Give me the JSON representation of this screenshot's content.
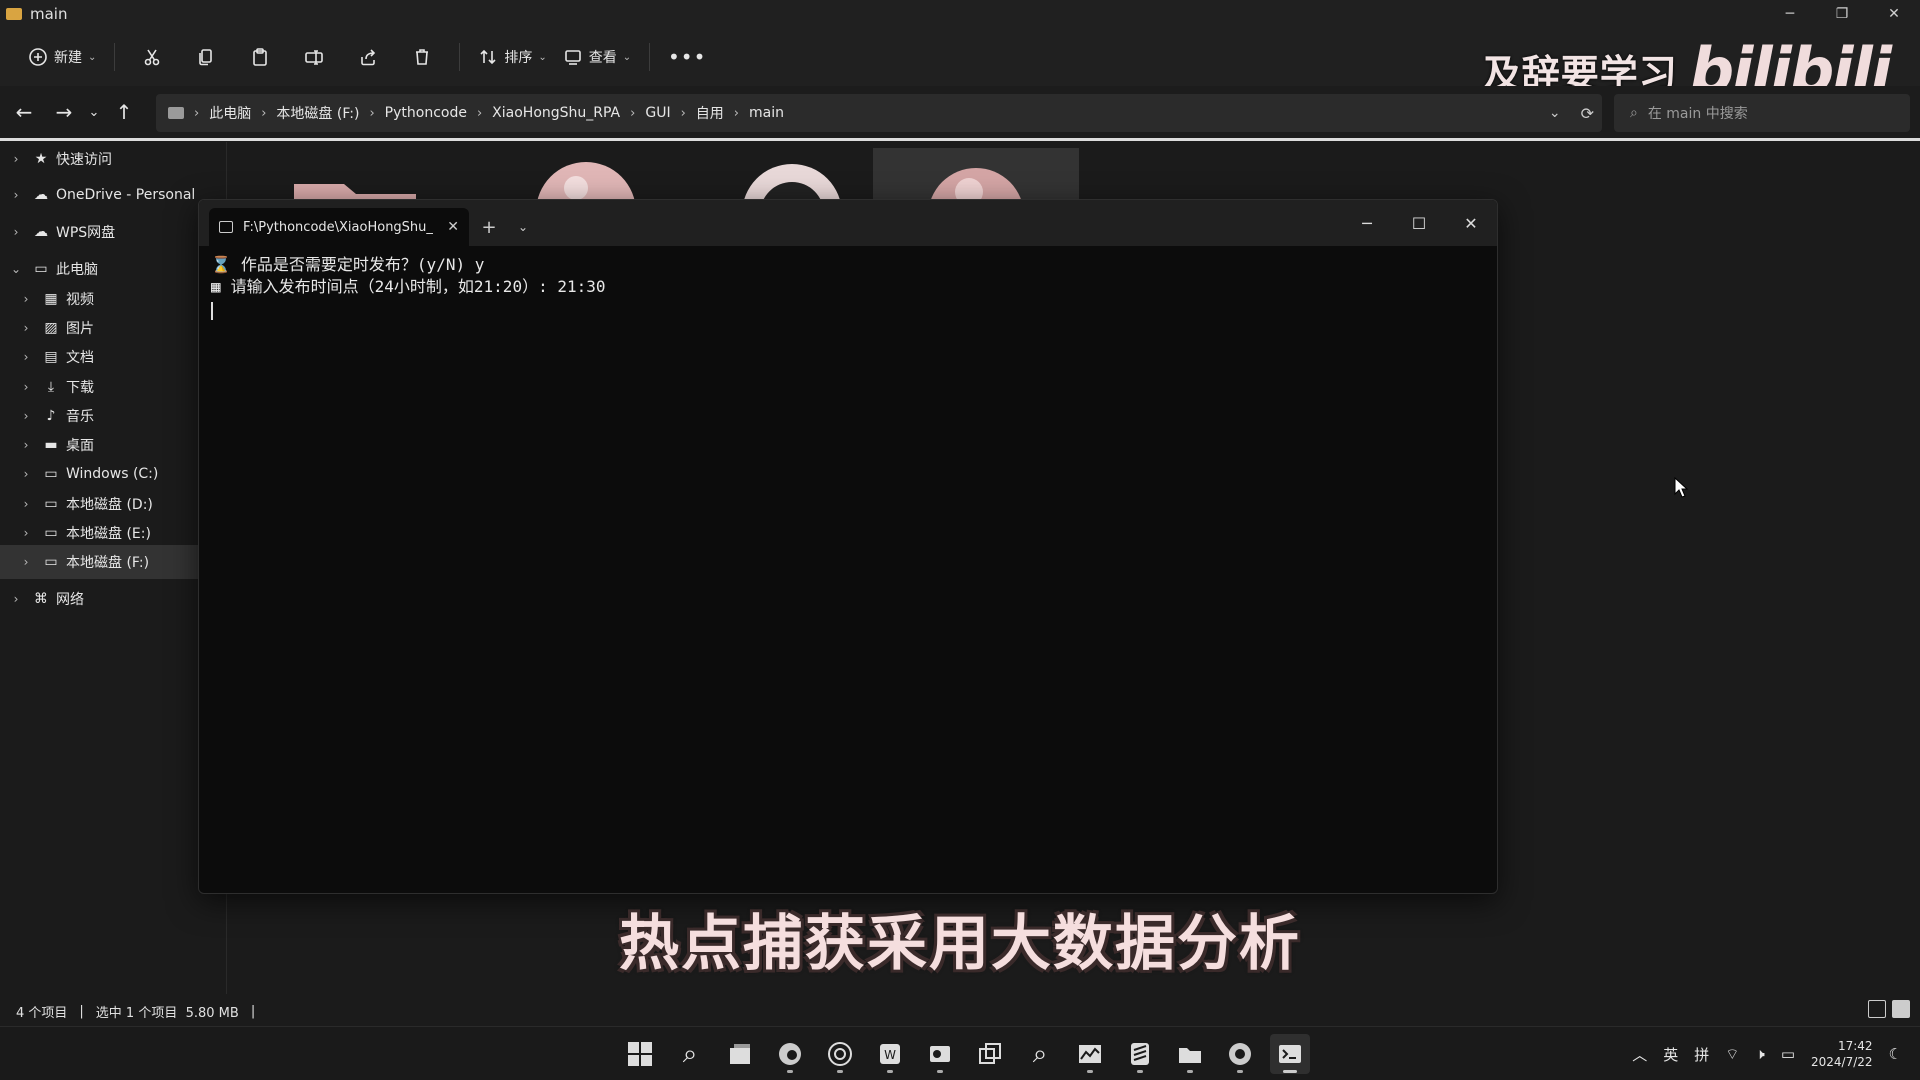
{
  "window": {
    "title": "main"
  },
  "toolbar": {
    "new_label": "新建",
    "sort_label": "排序",
    "view_label": "查看"
  },
  "watermark": {
    "text": "及辞要学习",
    "logo": "bilibili"
  },
  "breadcrumb": [
    "此电脑",
    "本地磁盘 (F:)",
    "Pythoncode",
    "XiaoHongShu_RPA",
    "GUI",
    "自用",
    "main"
  ],
  "search": {
    "placeholder": "在 main 中搜索"
  },
  "sidebar": {
    "items": [
      {
        "label": "快速访问",
        "icon": "star-icon"
      },
      {
        "label": "OneDrive - Personal",
        "icon": "cloud-icon"
      },
      {
        "label": "WPS网盘",
        "icon": "wps-cloud-icon"
      },
      {
        "label": "此电脑",
        "icon": "computer-icon"
      },
      {
        "label": "视频",
        "icon": "video-icon"
      },
      {
        "label": "图片",
        "icon": "picture-icon"
      },
      {
        "label": "文档",
        "icon": "document-icon"
      },
      {
        "label": "下载",
        "icon": "download-icon"
      },
      {
        "label": "音乐",
        "icon": "music-icon"
      },
      {
        "label": "桌面",
        "icon": "desktop-icon"
      },
      {
        "label": "Windows (C:)",
        "icon": "drive-icon"
      },
      {
        "label": "本地磁盘 (D:)",
        "icon": "drive-icon"
      },
      {
        "label": "本地磁盘 (E:)",
        "icon": "drive-icon"
      },
      {
        "label": "本地磁盘 (F:)",
        "icon": "drive-icon"
      },
      {
        "label": "网络",
        "icon": "network-icon"
      }
    ]
  },
  "terminal": {
    "tab_title": "F:\\Pythoncode\\XiaoHongShu_",
    "lines": [
      {
        "icon": "hourglass-icon",
        "text": "作品是否需要定时发布？(y/N) y"
      },
      {
        "icon": "calendar-icon",
        "text": "请输入发布时间点（24小时制，如21:20）: 21:30"
      }
    ]
  },
  "subtitle": "热点捕获采用大数据分析",
  "status": {
    "item_count": "4 个项目",
    "selected": "选中 1 个项目  5.80 MB"
  },
  "tray": {
    "ime_lang": "英",
    "ime_mode": "拼",
    "time": "17:42",
    "date": "2024/7/22"
  },
  "colors": {
    "background": "#1b1b1b",
    "terminal": "#0c0c0c",
    "subtitle": "#f5dede"
  }
}
